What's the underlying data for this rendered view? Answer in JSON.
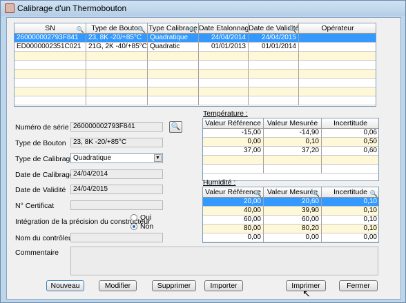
{
  "window": {
    "title": "Calibrage d'un Thermobouton"
  },
  "top_grid": {
    "columns": [
      "SN",
      "Type de Bouton",
      "Type Calibrage",
      "Date Etalonnage",
      "Date de Validité",
      "Opérateur"
    ],
    "rows": [
      [
        "260000002793F841",
        "23, 8K -20/+85°C",
        "Quadratique",
        "24/04/2014",
        "24/04/2015",
        ""
      ],
      [
        "ED0000002351C021",
        "21G, 2K -40/+85°C",
        "Quadratic",
        "01/01/2013",
        "01/01/2014",
        ""
      ]
    ]
  },
  "form": {
    "serial_label": "Numéro de série",
    "serial_value": "260000002793F841",
    "type_bouton_label": "Type de Bouton",
    "type_bouton_value": "23, 8K -20/+85°C",
    "type_calib_label": "Type de Calibrage (°C)",
    "type_calib_value": "Quadratique",
    "date_calib_label": "Date de Calibrage",
    "date_calib_value": "24/04/2014",
    "date_valid_label": "Date de Validité",
    "date_valid_value": "24/04/2015",
    "certificat_label": "N° Certificat",
    "certificat_value": "",
    "integration_label": "Intégration de la précision du constructeur",
    "radio_oui": "Oui",
    "radio_non": "Non",
    "controleur_label": "Nom du contrôleur",
    "controleur_value": "",
    "commentaire_label": "Commentaire"
  },
  "temperature": {
    "title": "Température :",
    "columns": [
      "Valeur Référence",
      "Valeur Mesurée",
      "Incertitude"
    ],
    "rows": [
      [
        "-15,00",
        "-14,90",
        "0,06"
      ],
      [
        "0,00",
        "0,10",
        "0,50"
      ],
      [
        "37,00",
        "37,20",
        "0,60"
      ]
    ]
  },
  "humidite": {
    "title": "Humidité :",
    "columns": [
      "Valeur Référence",
      "Valeur Mesurée",
      "Incertitude"
    ],
    "rows": [
      [
        "20,00",
        "20,60",
        "0,10"
      ],
      [
        "40,00",
        "39,90",
        "0,10"
      ],
      [
        "60,00",
        "60,00",
        "0,10"
      ],
      [
        "80,00",
        "80,20",
        "0,10"
      ],
      [
        "0,00",
        "0,00",
        "0,00"
      ]
    ]
  },
  "buttons": {
    "nouveau": "Nouveau",
    "modifier": "Modifier",
    "supprimer": "Supprimer",
    "importer": "Importer",
    "imprimer": "Imprimer",
    "fermer": "Fermer"
  }
}
